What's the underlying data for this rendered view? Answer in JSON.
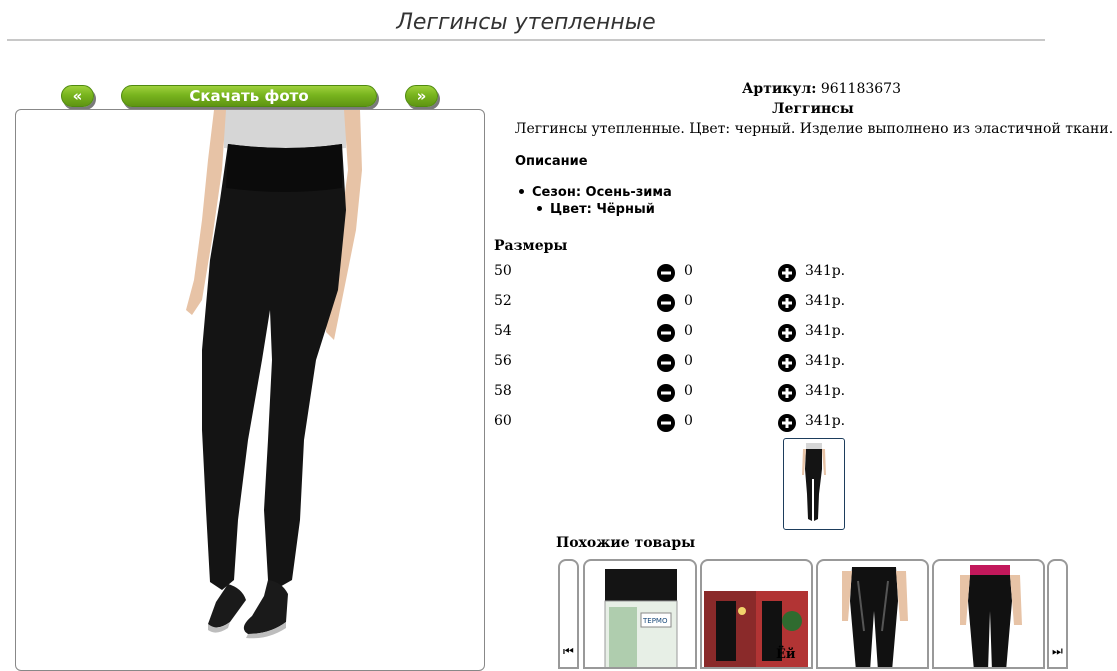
{
  "page": {
    "title": "Леггинсы утепленные"
  },
  "gallery": {
    "prev_label": "«",
    "download_label": "Скачать фото",
    "next_label": "»"
  },
  "product": {
    "article_label": "Артикул:",
    "article_value": "961183673",
    "name": "Леггинсы",
    "description": "Леггинсы утепленные. Цвет: черный. Изделие выполнено из эластичной ткани.",
    "details_heading": "Описание",
    "season": "Сезон: Осень-зима",
    "color": "Цвет: Чёрный"
  },
  "sizes": {
    "heading": "Размеры",
    "rows": [
      {
        "size": "50",
        "qty": "0",
        "price": "341р."
      },
      {
        "size": "52",
        "qty": "0",
        "price": "341р."
      },
      {
        "size": "54",
        "qty": "0",
        "price": "341р."
      },
      {
        "size": "56",
        "qty": "0",
        "price": "341р."
      },
      {
        "size": "58",
        "qty": "0",
        "price": "341р."
      },
      {
        "size": "60",
        "qty": "0",
        "price": "341р."
      }
    ]
  },
  "similar": {
    "heading": "Похожие товары",
    "prev_icon": "⏮",
    "next_icon": "⏭",
    "thumb_text": "ТЕРМО",
    "caption": "Ёй"
  },
  "colors": {
    "button_green": "#78b41e",
    "legging_black": "#141414",
    "shirt_grey": "#d6d6d6",
    "skin": "#e7c3a6"
  }
}
